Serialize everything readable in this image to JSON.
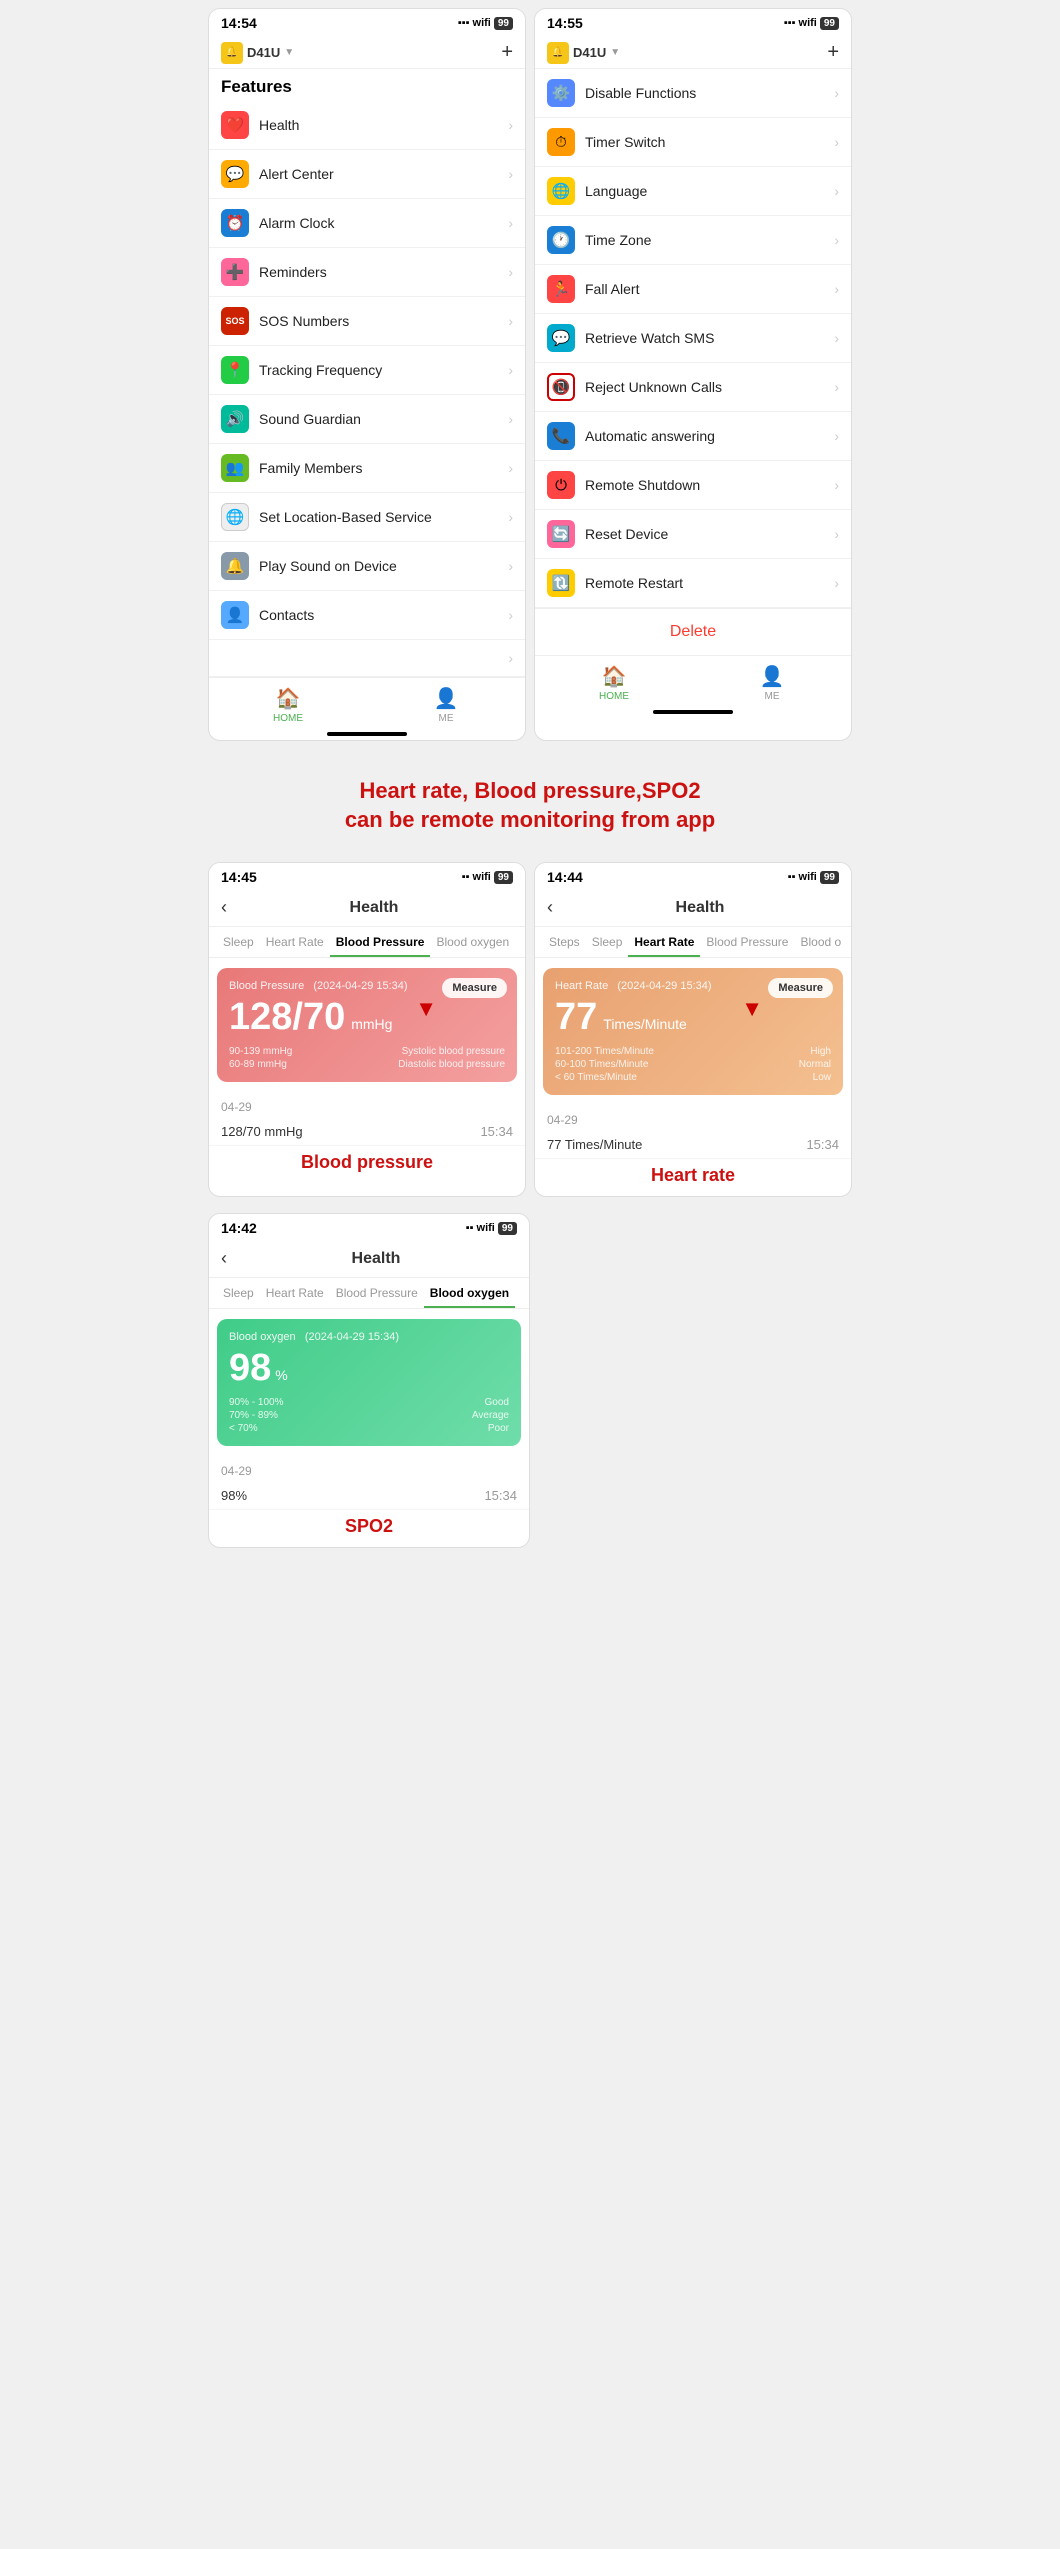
{
  "screens": {
    "left": {
      "status": {
        "time": "14:54",
        "battery": "99"
      },
      "device": "D41U",
      "section_title": "Features",
      "items": [
        {
          "label": "Health",
          "icon": "❤️",
          "color": "icon-red"
        },
        {
          "label": "Alert Center",
          "icon": "💬",
          "color": "icon-orange"
        },
        {
          "label": "Alarm Clock",
          "icon": "⏰",
          "color": "icon-blue"
        },
        {
          "label": "Reminders",
          "icon": "🩺",
          "color": "icon-pink"
        },
        {
          "label": "SOS Numbers",
          "icon": "SOS",
          "color": "icon-darkred"
        },
        {
          "label": "Tracking Frequency",
          "icon": "📍",
          "color": "icon-green"
        },
        {
          "label": "Sound Guardian",
          "icon": "🔊",
          "color": "icon-teal"
        },
        {
          "label": "Family Members",
          "icon": "👥",
          "color": "icon-lime"
        },
        {
          "label": "Set Location-Based Service",
          "icon": "🌐",
          "color": "icon-purple"
        },
        {
          "label": "Play Sound on Device",
          "icon": "🔔",
          "color": "icon-gray"
        },
        {
          "label": "Contacts",
          "icon": "👤",
          "color": "icon-cyan"
        }
      ],
      "nav": [
        {
          "label": "HOME",
          "icon": "🏠",
          "active": true
        },
        {
          "label": "ME",
          "icon": "👤",
          "active": false
        }
      ]
    },
    "right": {
      "status": {
        "time": "14:55",
        "battery": "99"
      },
      "device": "D41U",
      "items": [
        {
          "label": "Disable Functions",
          "icon": "⚙️",
          "color": "icon-blue"
        },
        {
          "label": "Timer Switch",
          "icon": "⏱",
          "color": "icon-orange"
        },
        {
          "label": "Language",
          "icon": "🌐",
          "color": "icon-yellow"
        },
        {
          "label": "Time Zone",
          "icon": "🕐",
          "color": "icon-blue"
        },
        {
          "label": "Fall Alert",
          "icon": "🏃",
          "color": "icon-red"
        },
        {
          "label": "Retrieve Watch SMS",
          "icon": "💬",
          "color": "icon-cyan"
        },
        {
          "label": "Reject Unknown Calls",
          "icon": "📵",
          "color": "icon-redborder"
        },
        {
          "label": "Automatic answering",
          "icon": "📞",
          "color": "icon-blue"
        },
        {
          "label": "Remote Shutdown",
          "icon": "⏻",
          "color": "icon-red"
        },
        {
          "label": "Reset Device",
          "icon": "🔄",
          "color": "icon-pink"
        },
        {
          "label": "Remote Restart",
          "icon": "🔃",
          "color": "icon-yellow"
        }
      ],
      "delete_label": "Delete",
      "nav": [
        {
          "label": "HOME",
          "icon": "🏠",
          "active": true
        },
        {
          "label": "ME",
          "icon": "👤",
          "active": false
        }
      ]
    }
  },
  "promo": {
    "line1": "Heart rate, Blood pressure,SPO2",
    "line2": "can be remote monitoring from app"
  },
  "health_screens": {
    "bp": {
      "status_time": "14:45",
      "title": "Health",
      "tabs": [
        "Sleep",
        "Heart Rate",
        "Blood Pressure",
        "Blood oxygen"
      ],
      "active_tab": "Blood Pressure",
      "card": {
        "subtitle": "Blood Pressure   (2024-04-29 15:34)",
        "value": "128/70",
        "unit": "mmHg",
        "measure_label": "Measure",
        "ranges": [
          {
            "range": "90-139 mmHg",
            "label": "Systolic blood pressure"
          },
          {
            "range": "60-89 mmHg",
            "label": "Diastolic blood pressure"
          }
        ]
      },
      "date": "04-29",
      "entries": [
        {
          "value": "128/70 mmHg",
          "time": "15:34"
        }
      ],
      "label": "Blood pressure"
    },
    "hr": {
      "status_time": "14:44",
      "title": "Health",
      "tabs": [
        "Steps",
        "Sleep",
        "Heart Rate",
        "Blood Pressure",
        "Blood o"
      ],
      "active_tab": "Heart Rate",
      "card": {
        "subtitle": "Heart Rate   (2024-04-29 15:34)",
        "value": "77",
        "unit": "Times/Minute",
        "measure_label": "Measure",
        "ranges": [
          {
            "range": "101-200 Times/Minute",
            "label": "High"
          },
          {
            "range": "60-100 Times/Minute",
            "label": "Normal"
          },
          {
            "range": "< 60 Times/Minute",
            "label": "Low"
          }
        ]
      },
      "date": "04-29",
      "entries": [
        {
          "value": "77 Times/Minute",
          "time": "15:34"
        }
      ],
      "label": "Heart rate"
    },
    "spo2": {
      "status_time": "14:42",
      "title": "Health",
      "tabs": [
        "Sleep",
        "Heart Rate",
        "Blood Pressure",
        "Blood oxygen"
      ],
      "active_tab": "Blood oxygen",
      "card": {
        "subtitle": "Blood oxygen   (2024-04-29 15:34)",
        "value": "98",
        "unit": "%",
        "ranges": [
          {
            "range": "90% - 100%",
            "label": "Good"
          },
          {
            "range": "70% - 89%",
            "label": "Average"
          },
          {
            "range": "< 70%",
            "label": "Poor"
          }
        ]
      },
      "date": "04-29",
      "entries": [
        {
          "value": "98%",
          "time": "15:34"
        }
      ],
      "label": "SPO2"
    }
  }
}
